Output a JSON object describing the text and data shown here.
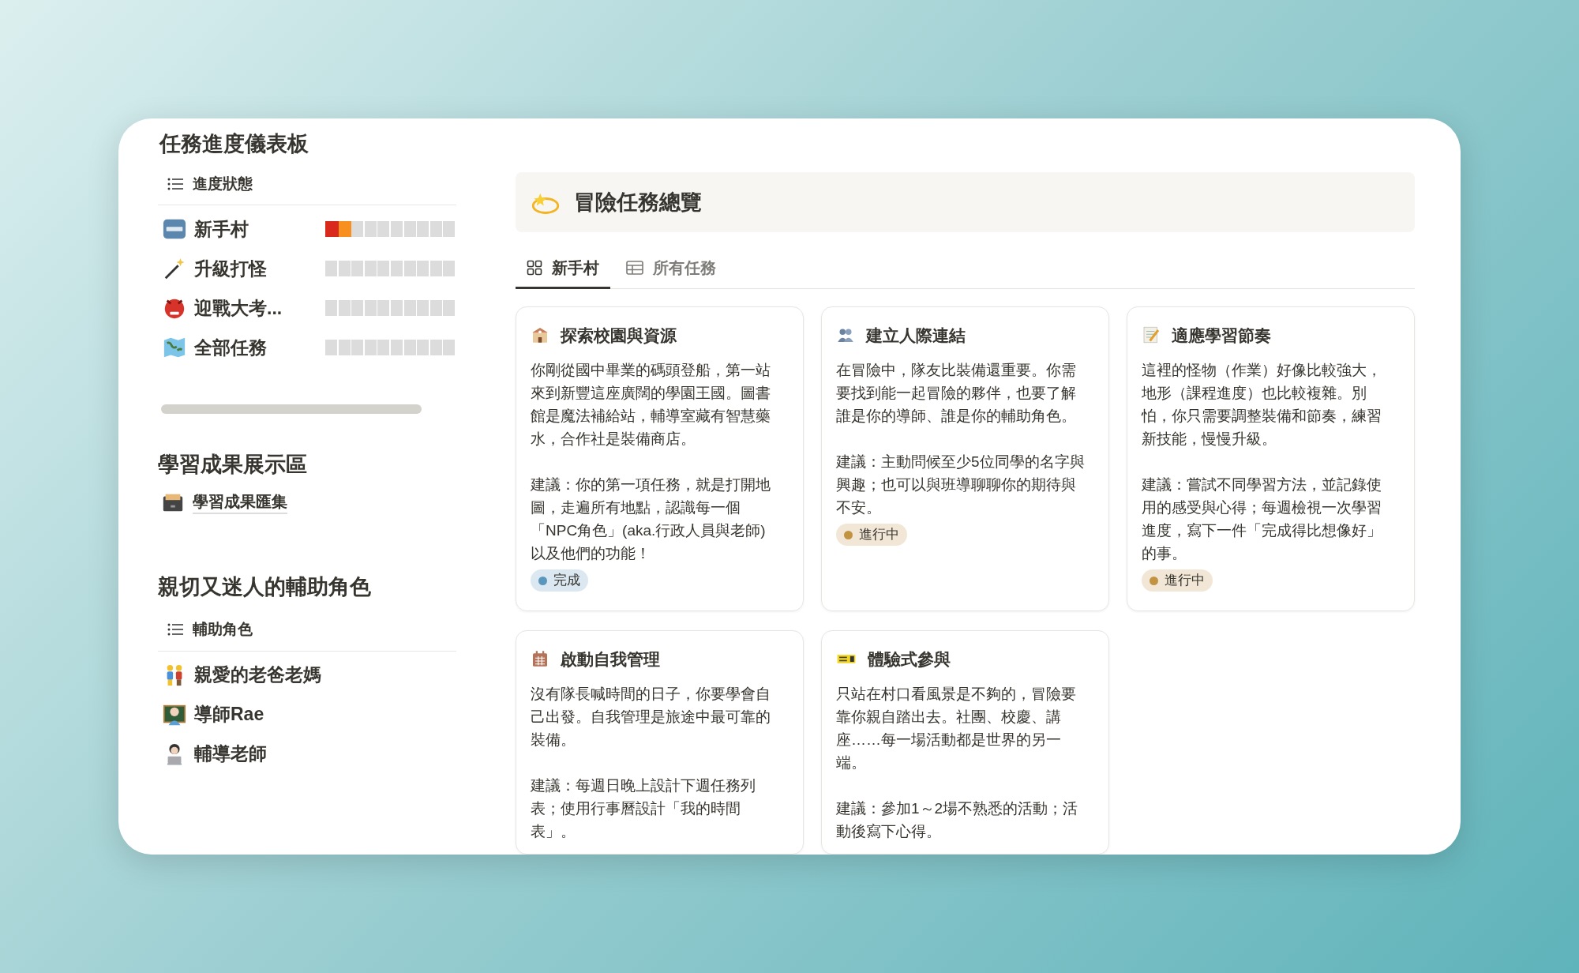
{
  "dashboard": {
    "title": "任務進度儀表板",
    "view": {
      "label": "進度狀態"
    },
    "rows": [
      {
        "label": "新手村",
        "level": 0.2
      },
      {
        "label": "升級打怪"
      },
      {
        "label": "迎戰大考..."
      },
      {
        "label": "全部任務"
      }
    ]
  },
  "showcase": {
    "title": "學習成果展示區",
    "link": {
      "label": "學習成果匯集"
    }
  },
  "helpers": {
    "title": "親切又迷人的輔助角色",
    "view": {
      "label": "輔助角色"
    },
    "items": [
      {
        "label": "親愛的老爸老媽"
      },
      {
        "label": "導師Rae"
      },
      {
        "label": "輔導老師"
      }
    ]
  },
  "overview": {
    "title": "冒險任務總覽",
    "tabs": [
      {
        "label": "新手村",
        "selected": true
      },
      {
        "label": "所有任務",
        "selected": false
      }
    ],
    "cards": [
      {
        "title": "探索校園與資源",
        "paragraphs": [
          "你剛從國中畢業的碼頭登船，第一站來到新豐這座廣闊的學園王國。圖書館是魔法補給站，輔導室藏有智慧藥水，合作社是裝備商店。",
          "建議：你的第一項任務，就是打開地圖，走遍所有地點，認識每一個「NPC角色」(aka.行政人員與老師)以及他們的功能！"
        ],
        "status": {
          "label": "完成",
          "color": "#5b97bd"
        }
      },
      {
        "title": "建立人際連結",
        "paragraphs": [
          "在冒險中，隊友比裝備還重要。你需要找到能一起冒險的夥伴，也要了解誰是你的導師、誰是你的輔助角色。",
          "建議：主動問候至少5位同學的名字與興趣；也可以與班導聊聊你的期待與不安。"
        ],
        "status": {
          "label": "進行中",
          "color": "#c29343"
        }
      },
      {
        "title": "適應學習節奏",
        "paragraphs": [
          "這裡的怪物（作業）好像比較強大，地形（課程進度）也比較複雜。別怕，你只需要調整裝備和節奏，練習新技能，慢慢升級。",
          "建議：嘗試不同學習方法，並記錄使用的感受與心得；每週檢視一次學習進度，寫下一件「完成得比想像好」的事。"
        ],
        "status": {
          "label": "進行中",
          "color": "#c29343"
        }
      },
      {
        "title": "啟動自我管理",
        "paragraphs": [
          "沒有隊長喊時間的日子，你要學會自己出發。自我管理是旅途中最可靠的裝備。",
          "建議：每週日晚上設計下週任務列表；使用行事曆設計「我的時間表」。"
        ]
      },
      {
        "title": "體驗式參與",
        "paragraphs": [
          "只站在村口看風景是不夠的，冒險要靠你親自踏出去。社團、校慶、講座……每一場活動都是世界的另一端。",
          "建議：參加1～2場不熟悉的活動；活動後寫下心得。"
        ]
      }
    ]
  }
}
